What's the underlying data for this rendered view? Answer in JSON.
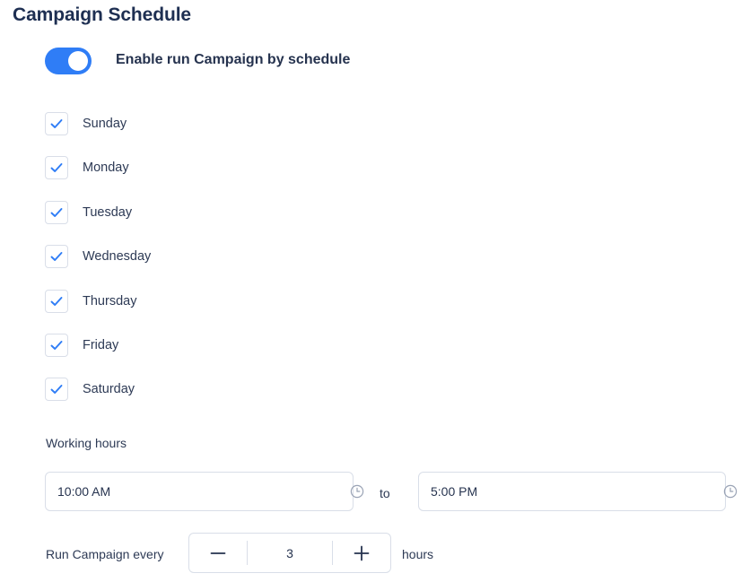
{
  "header": {
    "title": "Campaign Schedule"
  },
  "schedule_toggle": {
    "label": "Enable run Campaign by schedule",
    "enabled": true,
    "color": "#2f7df6"
  },
  "days": [
    {
      "label": "Sunday",
      "checked": true
    },
    {
      "label": "Monday",
      "checked": true
    },
    {
      "label": "Tuesday",
      "checked": true
    },
    {
      "label": "Wednesday",
      "checked": true
    },
    {
      "label": "Thursday",
      "checked": true
    },
    {
      "label": "Friday",
      "checked": true
    },
    {
      "label": "Saturday",
      "checked": true
    }
  ],
  "working_hours": {
    "label": "Working hours",
    "start": "10:00 AM",
    "separator": "to",
    "end": "5:00 PM",
    "icon": "clock-icon"
  },
  "run_every": {
    "label": "Run Campaign every",
    "value": "3",
    "unit": "hours",
    "decrement_icon": "minus-icon",
    "increment_icon": "plus-icon"
  },
  "colors": {
    "accent": "#2f7df6",
    "check": "#2f7df6",
    "text": "#26334f",
    "border": "#d9dee8"
  }
}
